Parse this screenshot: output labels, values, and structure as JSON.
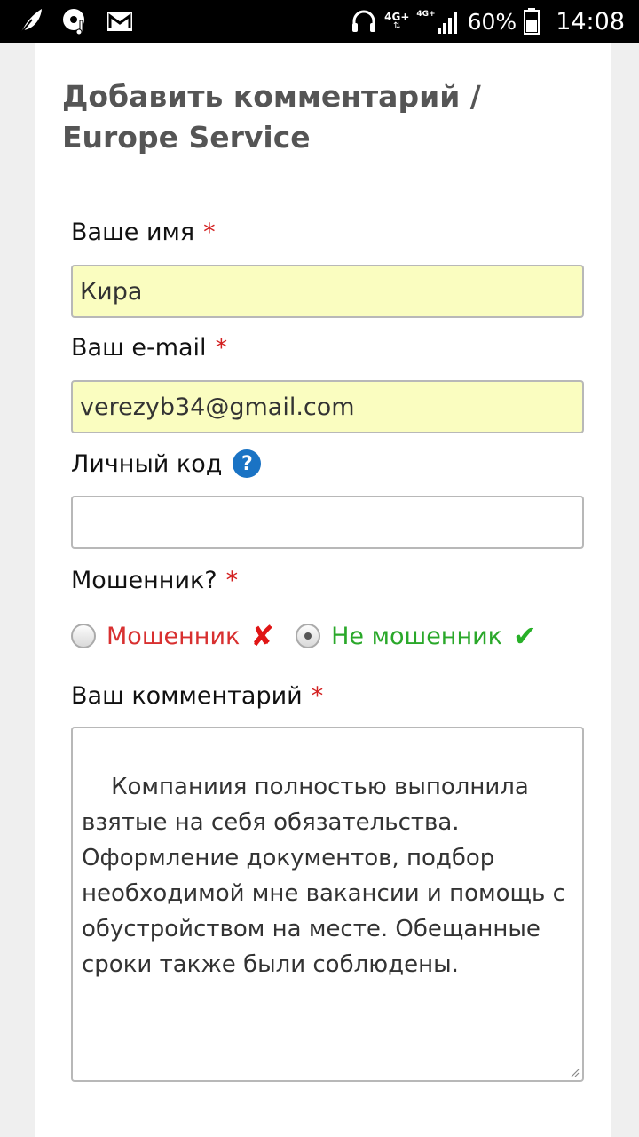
{
  "status_bar": {
    "network": "4G+",
    "network2": "4G+",
    "battery": "60%",
    "time": "14:08",
    "icons": [
      "feather-icon",
      "music-disc-icon",
      "gmail-icon",
      "headphones-icon",
      "signal-icon",
      "battery-icon"
    ]
  },
  "form": {
    "title": "Добавить комментарий / Europe Service",
    "name_label": "Ваше имя",
    "name_value": "Кира",
    "email_label": "Ваш e-mail",
    "email_value": "verezyb34@gmail.com",
    "code_label": "Личный код",
    "code_value": "",
    "help_symbol": "?",
    "fraud_label": "Мошенник?",
    "option_fraud": "Мошенник",
    "option_not_fraud": "Не мошенник",
    "selected_option": "Не мошенник",
    "comment_label": "Ваш комментарий",
    "comment_value": "Компаниия полностью выполнила взятые на себя обязательства. Оформление документов, подбор необходимой мне вакансии и помощь с обустройством на месте. Обещанные сроки также были соблюдены.",
    "required_mark": "*",
    "cross_mark": "✘",
    "check_mark": "✔"
  },
  "colors": {
    "filled_field": "#fafdc0",
    "required": "#d32020",
    "fraud": "#d83030",
    "not_fraud": "#2aa82a",
    "help": "#1a73c4"
  }
}
